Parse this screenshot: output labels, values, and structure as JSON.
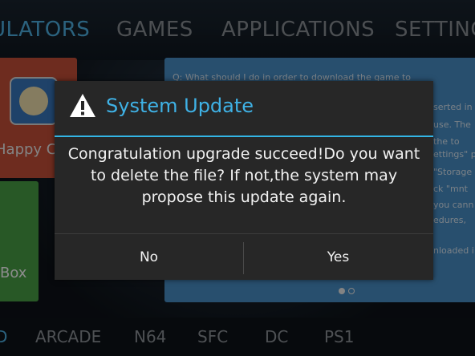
{
  "top_tabs": [
    "ULATORS",
    "GAMES",
    "APPLICATIONS",
    "SETTING"
  ],
  "game_tile": {
    "label": "Happy C",
    "icon": "happy-chick-icon"
  },
  "green_tile": {
    "label": "Box"
  },
  "faq": {
    "lines": [
      "Q: What should I do in order to download the game to",
      "serted in",
      "use. The",
      "the to",
      "ettings\" p",
      "\"Storage",
      "ck \"mnt",
      "you cann",
      "edures,",
      "nloaded i"
    ]
  },
  "bottom_tabs": [
    "D",
    "ARCADE",
    "N64",
    "SFC",
    "DC",
    "PS1"
  ],
  "dialog": {
    "icon": "warning-icon",
    "title": "System Update",
    "message": "Congratulation upgrade succeed!Do you want to delete the file? If not,the system may propose this update again.",
    "no_label": "No",
    "yes_label": "Yes"
  },
  "colors": {
    "accent": "#33b5e5",
    "dialog_bg": "#272727"
  }
}
